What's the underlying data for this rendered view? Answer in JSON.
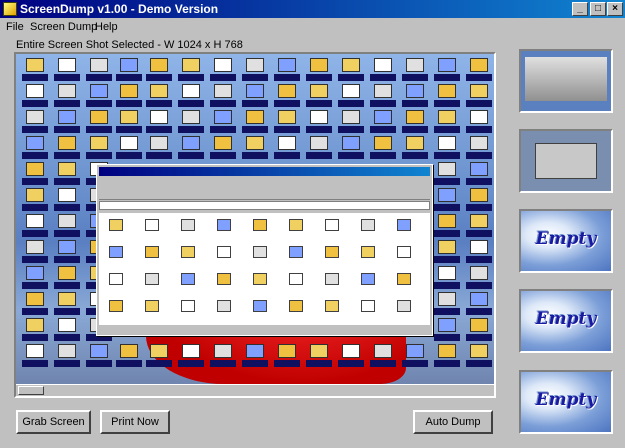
{
  "window": {
    "title": "ScreenDump v1.00 - Demo Version",
    "controls": {
      "minimize": "_",
      "maximize": "□",
      "close": "×"
    }
  },
  "menu": [
    "File",
    "Screen Dump",
    "Help"
  ],
  "status_text": "Entire Screen Shot Selected - W 1024 x H 768",
  "thumbnails": {
    "empty_label": "Empty",
    "slots": [
      "screenshot",
      "screenshot",
      "empty",
      "empty",
      "empty"
    ]
  },
  "buttons": {
    "grab": "Grab Screen",
    "print": "Print Now",
    "auto": "Auto Dump"
  },
  "colors": {
    "titlebar": "#000080",
    "face": "#c0c0c0",
    "empty_text": "#1a1aa0"
  }
}
